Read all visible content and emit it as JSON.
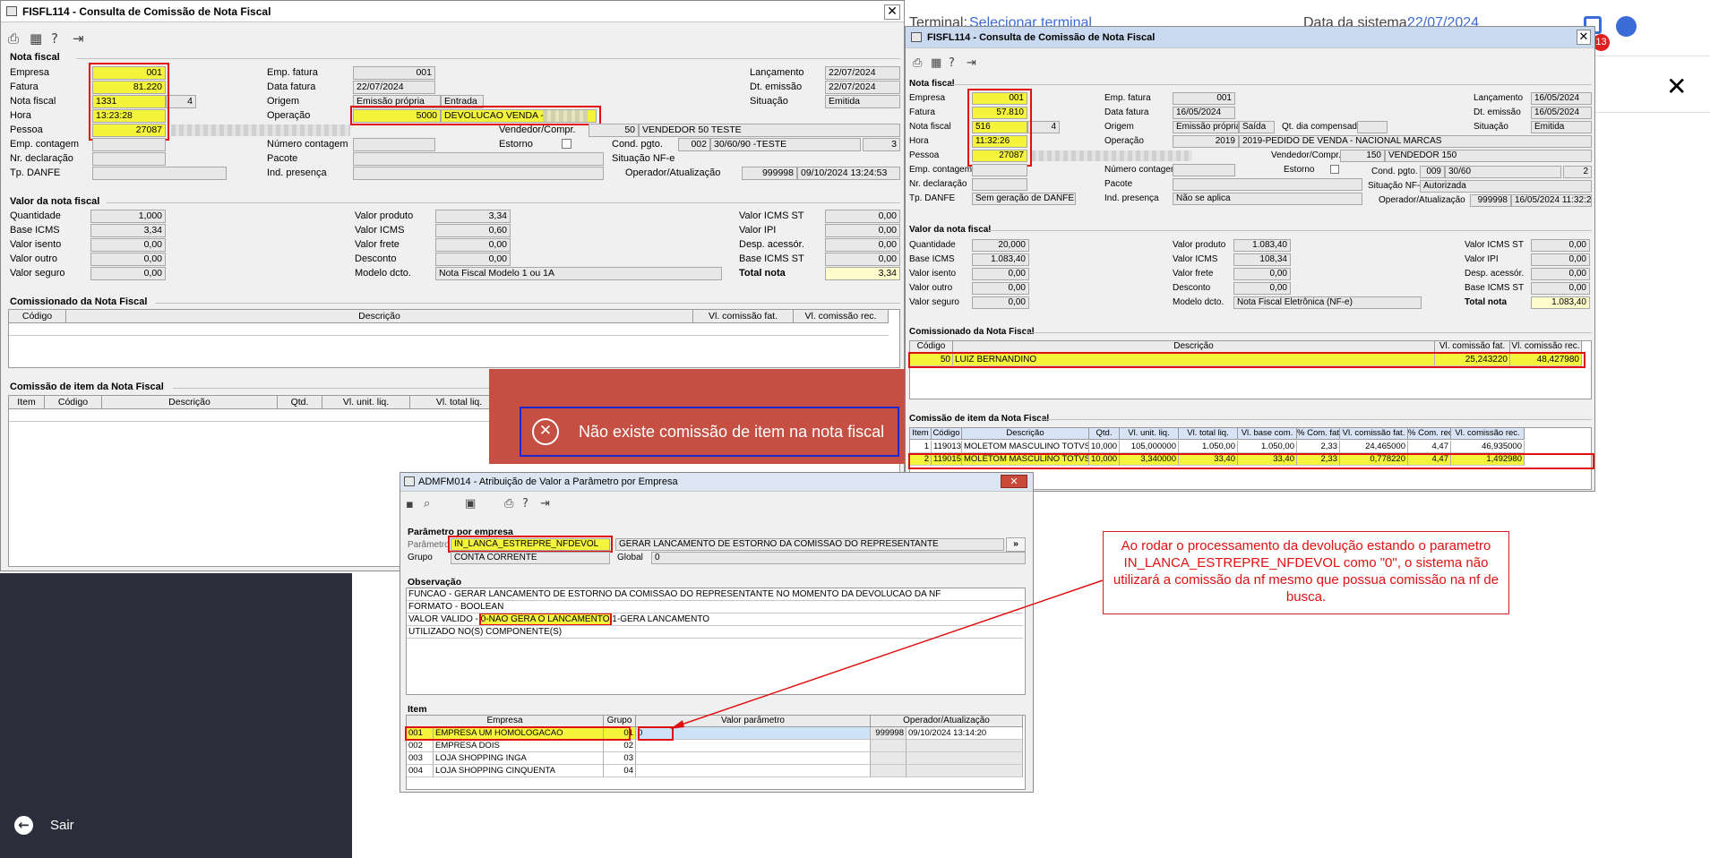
{
  "background": {
    "terminal_label": "Terminal:",
    "terminal_value": "Selecionar terminal",
    "date_label": "Data da sistema:",
    "date_value": "22/07/2024",
    "badge_count": "13",
    "sair": "Sair"
  },
  "win1": {
    "title": "FISFL114 - Consulta de Comissão de Nota Fiscal",
    "nf": {
      "section": "Nota fiscal",
      "empresa_l": "Empresa",
      "empresa": "001",
      "fatura_l": "Fatura",
      "fatura": "81.220",
      "nota_l": "Nota fiscal",
      "nota": "1331",
      "nota_suffix": "4",
      "hora_l": "Hora",
      "hora": "13:23:28",
      "pessoa_l": "Pessoa",
      "pessoa": "27087",
      "empcont_l": "Emp. contagem",
      "nrdecl_l": "Nr. declaração",
      "tpdanfe_l": "Tp. DANFE",
      "empfat_l": "Emp. fatura",
      "empfat": "001",
      "datafat_l": "Data fatura",
      "datafat": "22/07/2024",
      "origem_l": "Origem",
      "origem": "Emissão própria",
      "origem2": "Entrada",
      "operacao_l": "Operação",
      "operacao": "5000",
      "operacao_desc": "DEVOLUCAO VENDA -",
      "numcont_l": "Número contagem",
      "pacote_l": "Pacote",
      "indpres_l": "Ind. presença",
      "vendedor_l": "Vendedor/Compr.",
      "vendedor_cod": "50",
      "vendedor": "VENDEDOR 50 TESTE",
      "estorno_l": "Estorno",
      "condpgto_l": "Cond. pgto.",
      "condpgto_cod": "002",
      "condpgto": "30/60/90 -TESTE",
      "condpgto_n": "3",
      "sitnfe_l": "Situação NF-e",
      "lanc_l": "Lançamento",
      "lanc": "22/07/2024",
      "dtemis_l": "Dt. emissão",
      "dtemis": "22/07/2024",
      "situacao_l": "Situação",
      "situacao": "Emitida",
      "operador_l": "Operador/Atualização",
      "operador": "999998",
      "operador_dt": "09/10/2024 13:24:53"
    },
    "valor": {
      "section": "Valor da nota fiscal",
      "qtd_l": "Quantidade",
      "qtd": "1,000",
      "baseicms_l": "Base ICMS",
      "baseicms": "3,34",
      "visento_l": "Valor isento",
      "visento": "0,00",
      "voutro_l": "Valor outro",
      "voutro": "0,00",
      "vseguro_l": "Valor seguro",
      "vseguro": "0,00",
      "vprod_l": "Valor produto",
      "vprod": "3,34",
      "vicms_l": "Valor ICMS",
      "vicms": "0,60",
      "vfrete_l": "Valor frete",
      "vfrete": "0,00",
      "desc_l": "Desconto",
      "desc": "0,00",
      "modelo_l": "Modelo dcto.",
      "modelo": "Nota Fiscal Modelo 1 ou 1A",
      "vicmsst_l": "Valor ICMS ST",
      "vicmsst": "0,00",
      "vipi_l": "Valor IPI",
      "vipi": "0,00",
      "despac_l": "Desp. acessór.",
      "despac": "0,00",
      "baseicmsst_l": "Base ICMS ST",
      "baseicmsst": "0,00",
      "total_l": "Total nota",
      "total": "3,34"
    },
    "comiss": {
      "section": "Comissionado da Nota Fiscal",
      "h_codigo": "Código",
      "h_desc": "Descrição",
      "h_vlfat": "Vl. comissão fat.",
      "h_vlrec": "Vl. comissão rec."
    },
    "item": {
      "section": "Comissão de item da Nota Fiscal",
      "h_item": "Item",
      "h_codigo": "Código",
      "h_desc": "Descrição",
      "h_qtd": "Qtd.",
      "h_vunit": "Vl. unit. liq.",
      "h_vtotal": "Vl. total liq."
    }
  },
  "toast": {
    "message": "Não existe comissão de item na nota fiscal"
  },
  "win2": {
    "title": "FISFL114 - Consulta de Comissão de Nota Fiscal",
    "nf": {
      "section": "Nota fiscal",
      "empresa_l": "Empresa",
      "empresa": "001",
      "fatura_l": "Fatura",
      "fatura": "57.810",
      "nota_l": "Nota fiscal",
      "nota": "516",
      "nota_suffix": "4",
      "hora_l": "Hora",
      "hora": "11:32:26",
      "pessoa_l": "Pessoa",
      "pessoa": "27087",
      "empcont_l": "Emp. contagem",
      "nrdecl_l": "Nr. declaração",
      "tpdanfe_l": "Tp. DANFE",
      "tpdanfe": "Sem geração de DANFE",
      "empfat_l": "Emp. fatura",
      "empfat": "001",
      "datafat_l": "Data fatura",
      "datafat": "16/05/2024",
      "origem_l": "Origem",
      "origem": "Emissão própria",
      "origem2": "Saída",
      "qtdia_l": "Qt. dia compensado",
      "operacao_l": "Operação",
      "operacao": "2019",
      "operacao_desc": "2019-PEDIDO DE VENDA - NACIONAL MARCAS",
      "numcont_l": "Número contagem",
      "pacote_l": "Pacote",
      "indpres_l": "Ind. presença",
      "indpres": "Não se aplica",
      "vendedor_l": "Vendedor/Compr.",
      "vendedor_cod": "150",
      "vendedor": "VENDEDOR 150",
      "estorno_l": "Estorno",
      "condpgto_l": "Cond. pgto.",
      "condpgto_cod": "009",
      "condpgto": "30/60",
      "condpgto_n": "2",
      "sitnfe_l": "Situação NF-e",
      "sitnfe": "Autorizada",
      "lanc_l": "Lançamento",
      "lanc": "16/05/2024",
      "dtemis_l": "Dt. emissão",
      "dtemis": "16/05/2024",
      "situacao_l": "Situação",
      "situacao": "Emitida",
      "operador_l": "Operador/Atualização",
      "operador": "999998",
      "operador_dt": "16/05/2024 11:32:26"
    },
    "valor": {
      "section": "Valor da nota fiscal",
      "qtd_l": "Quantidade",
      "qtd": "20,000",
      "baseicms_l": "Base ICMS",
      "baseicms": "1.083,40",
      "visento_l": "Valor isento",
      "visento": "0,00",
      "voutro_l": "Valor outro",
      "voutro": "0,00",
      "vseguro_l": "Valor seguro",
      "vseguro": "0,00",
      "vprod_l": "Valor produto",
      "vprod": "1.083,40",
      "vicms_l": "Valor ICMS",
      "vicms": "108,34",
      "vfrete_l": "Valor frete",
      "vfrete": "0,00",
      "desc_l": "Desconto",
      "desc": "0,00",
      "modelo_l": "Modelo dcto.",
      "modelo": "Nota Fiscal Eletrônica (NF-e)",
      "vicmsst_l": "Valor ICMS ST",
      "vicmsst": "0,00",
      "vipi_l": "Valor IPI",
      "vipi": "0,00",
      "despac_l": "Desp. acessór.",
      "despac": "0,00",
      "baseicmsst_l": "Base ICMS ST",
      "baseicmsst": "0,00",
      "total_l": "Total nota",
      "total": "1.083,40"
    },
    "comiss": {
      "section": "Comissionado da Nota Fiscal",
      "h_codigo": "Código",
      "h_desc": "Descrição",
      "h_vlfat": "Vl. comissão fat.",
      "h_vlrec": "Vl. comissão rec.",
      "row": {
        "codigo": "50",
        "desc": "LUIZ BERNANDINO",
        "vlfat": "25,243220",
        "vlrec": "48,427980"
      }
    },
    "item": {
      "section": "Comissão de item da Nota Fiscal",
      "headers": [
        "Item",
        "Código",
        "Descrição",
        "Qtd.",
        "Vl. unit. liq.",
        "Vl. total liq.",
        "Vl. base com.",
        "% Com. fat.",
        "Vl. comissão fat.",
        "% Com. rec.",
        "Vl. comissão rec."
      ],
      "rows": [
        [
          "1",
          "119013",
          "MOLETOM MASCULINO TOTVS MODA",
          "10,000",
          "105,000000",
          "1.050,00",
          "1.050,00",
          "2,33",
          "24,465000",
          "4,47",
          "46,935000"
        ],
        [
          "2",
          "119015",
          "MOLETOM MASCULINO TOTVS MODA",
          "10,000",
          "3,340000",
          "33,40",
          "33,40",
          "2,33",
          "0,778220",
          "4,47",
          "1,492980"
        ]
      ]
    }
  },
  "win3": {
    "title": "ADMFM014 - Atribuição de Valor a Parâmetro por Empresa",
    "sect_param": "Parâmetro por empresa",
    "param_l": "Parâmetro",
    "param": "IN_LANCA_ESTREPRE_NFDEVOL",
    "param_desc": "GERAR LANCAMENTO DE ESTORNO DA COMISSAO DO REPRESENTANTE",
    "grupo_l": "Grupo",
    "grupo": "CONTA CORRENTE",
    "global_l": "Global",
    "global": "0",
    "sect_obs": "Observação",
    "obs1": "FUNCAO - GERAR LANCAMENTO DE ESTORNO DA COMISSAO DO REPRESENTANTE NO MOMENTO DA DEVOLUCAO DA NF",
    "obs2": "FORMATO - BOOLEAN",
    "obs3a": "VALOR VALIDO - ",
    "obs3b": "0-NAO GERA O LANCAMENTO",
    "obs3c": "1-GERA LANCAMENTO",
    "obs4": "UTILIZADO NO(S) COMPONENTE(S)",
    "sect_item": "Item",
    "h_empresa": "Empresa",
    "h_grupo": "Grupo",
    "h_valor": "Valor parâmetro",
    "h_operador": "Operador/Atualização",
    "rows": [
      {
        "cod": "001",
        "nome": "EMPRESA UM HOMOLOGACAO",
        "grupo": "01",
        "valor": "0",
        "op": "999998",
        "dt": "09/10/2024 13:14:20"
      },
      {
        "cod": "002",
        "nome": "EMPRESA DOIS",
        "grupo": "02",
        "valor": "",
        "op": "",
        "dt": ""
      },
      {
        "cod": "003",
        "nome": "LOJA SHOPPING INGA",
        "grupo": "03",
        "valor": "",
        "op": "",
        "dt": ""
      },
      {
        "cod": "004",
        "nome": "LOJA SHOPPING CINQUENTA",
        "grupo": "04",
        "valor": "",
        "op": "",
        "dt": ""
      }
    ]
  },
  "callout": {
    "text": "Ao rodar o processamento da devolução estando o parametro IN_LANCA_ESTREPRE_NFDEVOL como \"0\", o sistema não utilizará a comissão da nf mesmo que possua comissão na nf de busca."
  }
}
